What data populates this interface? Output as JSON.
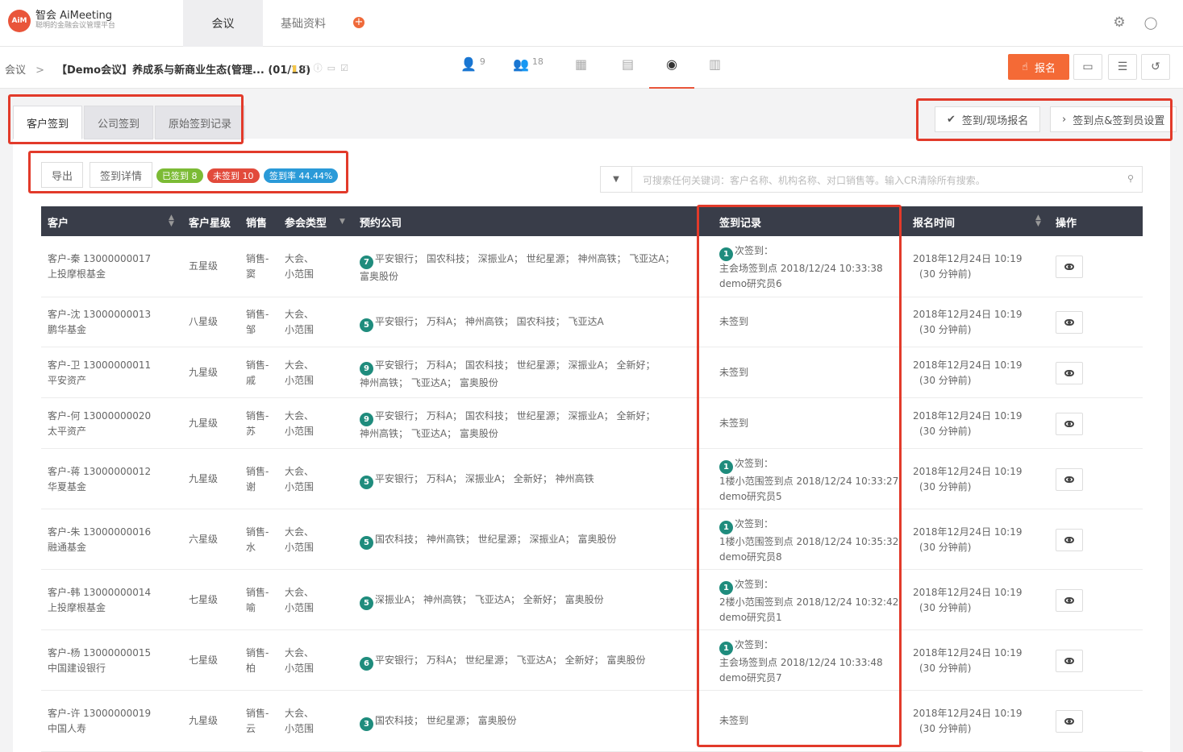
{
  "brand": {
    "logo_mark": "AiM",
    "name": "智会 AiMeeting",
    "tagline": "聪明的金融会议管理平台"
  },
  "nav": {
    "tabs": [
      {
        "label": "会议",
        "active": true
      },
      {
        "label": "基础资料",
        "active": false
      }
    ],
    "add_icon": "plus-circle-icon"
  },
  "breadcrumb": {
    "root": "会议",
    "separator": ">",
    "title": "【Demo会议】养成系与新商业生态(管理... (01/18)"
  },
  "meta_tabs": [
    {
      "icon": "person-icon",
      "glyph": "👤",
      "count": "9"
    },
    {
      "icon": "group-icon",
      "glyph": "👥",
      "count": "18"
    },
    {
      "icon": "calendar-icon",
      "glyph": "▦",
      "count": ""
    },
    {
      "icon": "document-icon",
      "glyph": "▤",
      "count": ""
    },
    {
      "icon": "checkin-person-icon",
      "glyph": "◉",
      "count": "",
      "active": true
    },
    {
      "icon": "chart-icon",
      "glyph": "▥",
      "count": ""
    }
  ],
  "actions": {
    "signup_label": "报名",
    "signup_icon": "hand-icon"
  },
  "subtabs": [
    "客户签到",
    "公司签到",
    "原始签到记录"
  ],
  "right_buttons": {
    "checkin_signup": "签到/现场报名",
    "checkin_settings": "签到点&签到员设置"
  },
  "toolbar": {
    "export": "导出",
    "details": "签到详情"
  },
  "badges": [
    {
      "label": "已签到 8",
      "color": "#7cbb35"
    },
    {
      "label": "未签到 10",
      "color": "#e24a3b"
    },
    {
      "label": "签到率 44.44%",
      "color": "#2a9ad8"
    }
  ],
  "search": {
    "placeholder": "可搜索任何关键词：客户名称、机构名称、对口销售等。输入CR清除所有搜索。"
  },
  "columns": [
    "客户",
    "客户星级",
    "销售",
    "参会类型",
    "预约公司",
    "签到记录",
    "报名时间",
    "操作"
  ],
  "rows": [
    {
      "customer": "客户-秦 13000000017",
      "org": "上投摩根基金",
      "star": "五星级",
      "sales1": "销售-",
      "sales2": "窦",
      "type1": "大会、",
      "type2": "小范围",
      "count": "7",
      "companies1": "平安银行； 国农科技； 深振业A； 世纪星源； 神州高铁； 飞亚达A；",
      "companies2": "富奥股份",
      "checkin_count": "1",
      "checkin_label": "次签到：",
      "checkin_place": "主会场签到点 2018/12/24 10:33:38",
      "checkin_by": "demo研究员6",
      "reg_time": "2018年12月24日 10:19",
      "reg_ago": "(30 分钟前)"
    },
    {
      "customer": "客户-沈 13000000013",
      "org": "鹏华基金",
      "star": "八星级",
      "sales1": "销售-",
      "sales2": "邹",
      "type1": "大会、",
      "type2": "小范围",
      "count": "5",
      "companies1": "平安银行； 万科A； 神州高铁； 国农科技； 飞亚达A",
      "companies2": "",
      "checkin_status": "未签到",
      "reg_time": "2018年12月24日 10:19",
      "reg_ago": "(30 分钟前)"
    },
    {
      "customer": "客户-卫 13000000011",
      "org": "平安资产",
      "star": "九星级",
      "sales1": "销售-",
      "sales2": "戚",
      "type1": "大会、",
      "type2": "小范围",
      "count": "9",
      "companies1": "平安银行； 万科A； 国农科技； 世纪星源； 深振业A； 全新好；",
      "companies2": "神州高铁； 飞亚达A； 富奥股份",
      "checkin_status": "未签到",
      "reg_time": "2018年12月24日 10:19",
      "reg_ago": "(30 分钟前)"
    },
    {
      "customer": "客户-何 13000000020",
      "org": "太平资产",
      "star": "九星级",
      "sales1": "销售-",
      "sales2": "苏",
      "type1": "大会、",
      "type2": "小范围",
      "count": "9",
      "companies1": "平安银行； 万科A； 国农科技； 世纪星源； 深振业A； 全新好；",
      "companies2": "神州高铁； 飞亚达A； 富奥股份",
      "checkin_status": "未签到",
      "reg_time": "2018年12月24日 10:19",
      "reg_ago": "(30 分钟前)"
    },
    {
      "customer": "客户-蒋 13000000012",
      "org": "华夏基金",
      "star": "九星级",
      "sales1": "销售-",
      "sales2": "谢",
      "type1": "大会、",
      "type2": "小范围",
      "count": "5",
      "companies1": "平安银行； 万科A； 深振业A； 全新好； 神州高铁",
      "companies2": "",
      "checkin_count": "1",
      "checkin_label": "次签到：",
      "checkin_place": "1楼小范围签到点 2018/12/24 10:33:27",
      "checkin_by": "demo研究员5",
      "reg_time": "2018年12月24日 10:19",
      "reg_ago": "(30 分钟前)"
    },
    {
      "customer": "客户-朱 13000000016",
      "org": "融通基金",
      "star": "六星级",
      "sales1": "销售-",
      "sales2": "水",
      "type1": "大会、",
      "type2": "小范围",
      "count": "5",
      "companies1": "国农科技； 神州高铁； 世纪星源； 深振业A； 富奥股份",
      "companies2": "",
      "checkin_count": "1",
      "checkin_label": "次签到：",
      "checkin_place": "1楼小范围签到点 2018/12/24 10:35:32",
      "checkin_by": "demo研究员8",
      "reg_time": "2018年12月24日 10:19",
      "reg_ago": "(30 分钟前)"
    },
    {
      "customer": "客户-韩 13000000014",
      "org": "上投摩根基金",
      "star": "七星级",
      "sales1": "销售-",
      "sales2": "喻",
      "type1": "大会、",
      "type2": "小范围",
      "count": "5",
      "companies1": "深振业A； 神州高铁； 飞亚达A； 全新好； 富奥股份",
      "companies2": "",
      "checkin_count": "1",
      "checkin_label": "次签到：",
      "checkin_place": "2楼小范围签到点 2018/12/24 10:32:42",
      "checkin_by": "demo研究员1",
      "reg_time": "2018年12月24日 10:19",
      "reg_ago": "(30 分钟前)"
    },
    {
      "customer": "客户-杨 13000000015",
      "org": "中国建设银行",
      "star": "七星级",
      "sales1": "销售-",
      "sales2": "柏",
      "type1": "大会、",
      "type2": "小范围",
      "count": "6",
      "companies1": "平安银行； 万科A； 世纪星源； 飞亚达A； 全新好； 富奥股份",
      "companies2": "",
      "checkin_count": "1",
      "checkin_label": "次签到：",
      "checkin_place": "主会场签到点 2018/12/24 10:33:48",
      "checkin_by": "demo研究员7",
      "reg_time": "2018年12月24日 10:19",
      "reg_ago": "(30 分钟前)"
    },
    {
      "customer": "客户-许 13000000019",
      "org": "中国人寿",
      "star": "九星级",
      "sales1": "销售-",
      "sales2": "云",
      "type1": "大会、",
      "type2": "小范围",
      "count": "3",
      "companies1": "国农科技； 世纪星源； 富奥股份",
      "companies2": "",
      "checkin_status": "未签到",
      "reg_time": "2018年12月24日 10:19",
      "reg_ago": "(30 分钟前)"
    }
  ]
}
